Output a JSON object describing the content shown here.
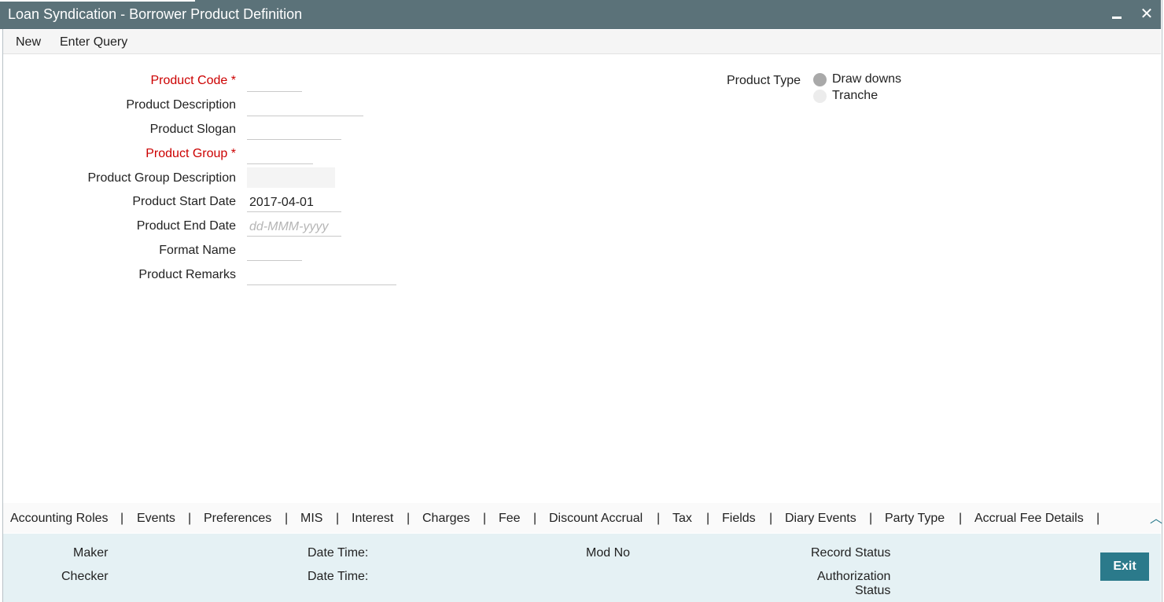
{
  "window": {
    "title": "Loan Syndication - Borrower Product Definition"
  },
  "menu": {
    "new": "New",
    "enter_query": "Enter Query"
  },
  "form": {
    "product_code": {
      "label": "Product Code",
      "required": "*",
      "value": ""
    },
    "product_description": {
      "label": "Product Description",
      "value": ""
    },
    "product_slogan": {
      "label": "Product Slogan",
      "value": ""
    },
    "product_group": {
      "label": "Product Group",
      "required": "*",
      "value": ""
    },
    "product_group_description": {
      "label": "Product Group Description",
      "value": ""
    },
    "product_start_date": {
      "label": "Product Start Date",
      "value": "2017-04-01"
    },
    "product_end_date": {
      "label": "Product End Date",
      "value": "",
      "placeholder": "dd-MMM-yyyy"
    },
    "format_name": {
      "label": "Format Name",
      "value": ""
    },
    "product_remarks": {
      "label": "Product Remarks",
      "value": ""
    }
  },
  "product_type": {
    "label": "Product Type",
    "options": [
      {
        "label": "Draw downs",
        "selected": true
      },
      {
        "label": "Tranche",
        "selected": false
      }
    ]
  },
  "tabs": [
    "Accounting Roles",
    "Events",
    "Preferences",
    "MIS",
    "Interest",
    "Charges",
    "Fee",
    "Discount Accrual",
    "Tax",
    "Fields",
    "Diary Events",
    "Party Type",
    "Accrual Fee Details"
  ],
  "tab_separator": "|",
  "footer": {
    "maker": "Maker",
    "checker": "Checker",
    "date_time_1": "Date Time:",
    "date_time_2": "Date Time:",
    "mod_no": "Mod No",
    "record_status": "Record Status",
    "authorization_status_line1": "Authorization",
    "authorization_status_line2": "Status",
    "exit": "Exit"
  },
  "colors": {
    "titlebar": "#5b7279",
    "required": "#cc0000",
    "accent": "#2b7a8b",
    "footer": "#e5f1f4"
  },
  "icons": {
    "minimize": "minimize-icon",
    "close": "close-icon",
    "scroll_up": "chevron-up-icon"
  }
}
